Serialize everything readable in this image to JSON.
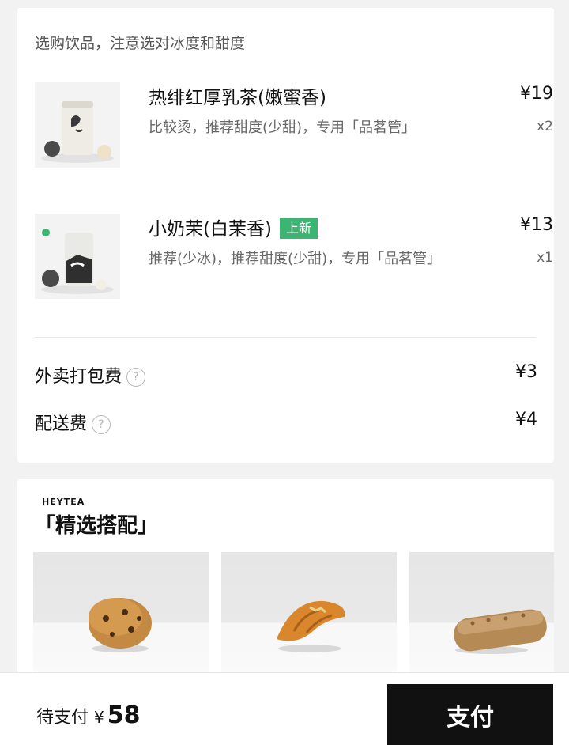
{
  "order": {
    "notice": "选购饮品，注意选对冰度和甜度",
    "items": [
      {
        "name": "热绯红厚乳茶(嫩蜜香)",
        "badge": "",
        "desc": "比较烫，推荐甜度(少甜)，专用「品茗管」",
        "price": "¥19",
        "qty": "x2"
      },
      {
        "name": "小奶茉(白茉香)",
        "badge": "上新",
        "desc": "推荐(少冰)，推荐甜度(少甜)，专用「品茗管」",
        "price": "¥13",
        "qty": "x1"
      }
    ],
    "fees": [
      {
        "label": "外卖打包费",
        "value": "¥3",
        "icon": "help-circle-icon"
      },
      {
        "label": "配送费",
        "value": "¥4",
        "icon": "help-circle-icon"
      }
    ]
  },
  "recommend": {
    "brand": "HEYTEA",
    "title": "「精选搭配」",
    "products": [
      {
        "name": "cookie"
      },
      {
        "name": "croissant"
      },
      {
        "name": "eclair"
      }
    ]
  },
  "paybar": {
    "pending_label": "待支付",
    "currency": "¥",
    "total": "58",
    "pay_button": "支付"
  },
  "colors": {
    "badge_green": "#3cb572",
    "pay_button_bg": "#111111",
    "page_bg": "#f2f2f2"
  }
}
